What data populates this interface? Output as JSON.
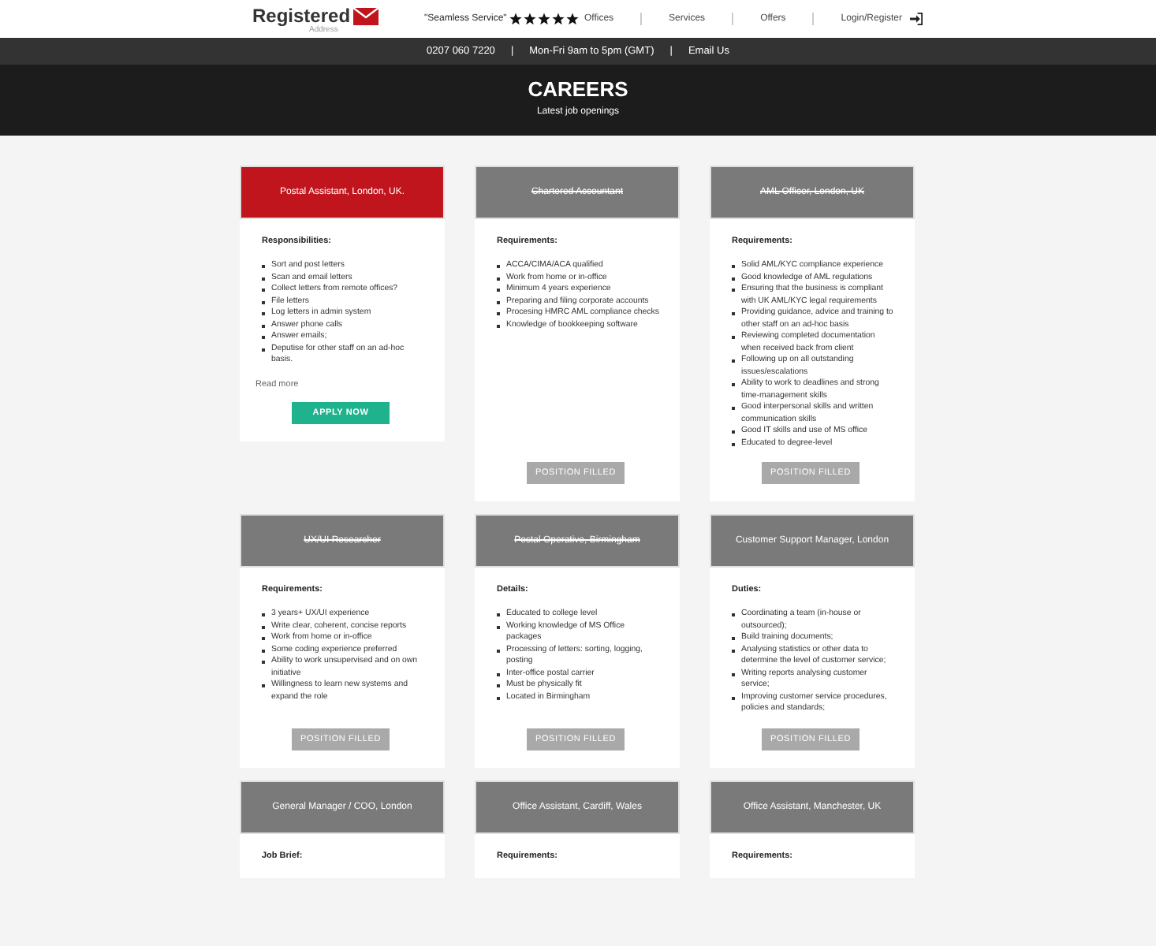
{
  "header": {
    "logo_text": "Registered",
    "logo_sub": "Address",
    "tagline": "\"Seamless Service\"",
    "stars": 5,
    "nav": [
      {
        "label": "Offices"
      },
      {
        "label": "Services"
      },
      {
        "label": "Offers"
      },
      {
        "label": "Login/Register"
      }
    ]
  },
  "contact_bar": {
    "items": [
      "0207 060 7220",
      "Mon-Fri  9am to 5pm (GMT)",
      "Email Us"
    ],
    "separator": "|"
  },
  "hero": {
    "title": "CAREERS",
    "subtitle": "Latest job openings"
  },
  "jobs": [
    {
      "title": "Postal Assistant, London, UK.",
      "filled": false,
      "open": true,
      "heading": "Responsibilities:",
      "items": [
        "Sort and post letters",
        "Scan and email letters",
        "Collect letters from remote offices?",
        "File letters",
        "Log letters in admin system",
        "Answer phone calls",
        "Answer emails;",
        "Deputise for other staff on an ad-hoc basis."
      ],
      "read_more": "Read more",
      "button": "APPLY NOW"
    },
    {
      "title": "Chartered Accountant",
      "filled": true,
      "open": false,
      "heading": "Requirements:",
      "items": [
        "ACCA/CIMA/ACA qualified",
        "Work from home or in-office",
        "Minimum 4 years experience",
        "Preparing and filing corporate accounts",
        "Procesing HMRC AML compliance checks",
        "Knowledge of bookkeeping software"
      ],
      "button": "POSITION FILLED"
    },
    {
      "title": "AML Officer, London, UK",
      "filled": true,
      "open": false,
      "heading": "Requirements:",
      "items": [
        "Solid AML/KYC compliance experience",
        "Good knowledge of AML regulations",
        "Ensuring that the business is compliant with UK AML/KYC legal requirements",
        "Providing guidance, advice and training to other staff on an ad-hoc basis",
        "Reviewing completed documentation when received back from client",
        "Following up on all outstanding issues/escalations",
        "Ability to work to deadlines and strong time-management skills",
        "Good interpersonal skills and written communication skills",
        "Good IT skills and use of MS office",
        "Educated to degree-level"
      ],
      "button": "POSITION FILLED"
    },
    {
      "title": "UX/UI Researcher",
      "filled": true,
      "open": false,
      "heading": "Requirements:",
      "items": [
        "3 years+ UX/UI experience",
        "Write clear, coherent, concise reports",
        "Work from home or in-office",
        "Some coding experience preferred",
        "Ability to work unsupervised and on own initiative",
        "Willingness to learn new systems and expand the role"
      ],
      "button": "POSITION FILLED"
    },
    {
      "title": "Postal Operative, Birmingham",
      "filled": true,
      "open": false,
      "heading": "Details:",
      "items": [
        "Educated to college level",
        "Working knowledge of MS Office packages",
        "Processing of letters: sorting, logging, posting",
        "Inter-office postal carrier",
        "Must be physically fit",
        "Located in Birmingham"
      ],
      "button": "POSITION FILLED"
    },
    {
      "title": "Customer Support Manager, London",
      "filled": false,
      "open": false,
      "heading": "Duties:",
      "items": [
        "Coordinating a team (in-house or outsourced);",
        "Build training documents;",
        "Analysing statistics or other data to determine the level of customer service;",
        "Writing reports analysing customer service;",
        "Improving customer service procedures, policies and standards;"
      ],
      "button": "POSITION FILLED"
    },
    {
      "title": "General Manager / COO, London",
      "filled": false,
      "open": false,
      "heading": "Job Brief:"
    },
    {
      "title": "Office Assistant, Cardiff, Wales",
      "filled": false,
      "open": false,
      "heading": "Requirements:"
    },
    {
      "title": "Office Assistant, Manchester, UK",
      "filled": false,
      "open": false,
      "heading": "Requirements:"
    }
  ]
}
